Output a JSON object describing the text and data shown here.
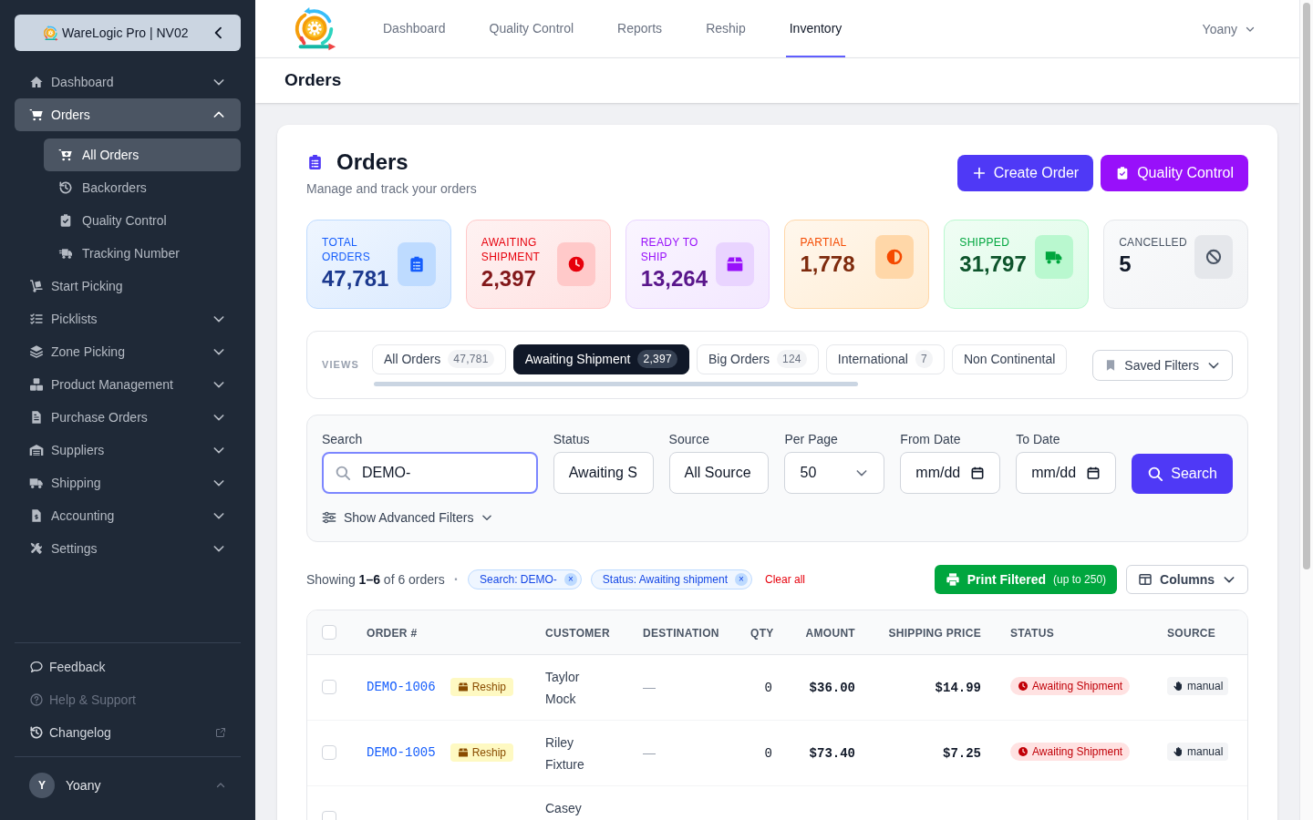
{
  "sidebar": {
    "brand": "WareLogic Pro | NV02",
    "nav": [
      {
        "label": "Dashboard",
        "kind": "group",
        "expanded": false,
        "selected": false
      },
      {
        "label": "Orders",
        "kind": "group",
        "expanded": true,
        "selected": true,
        "children": [
          {
            "label": "All Orders",
            "selected": true
          },
          {
            "label": "Backorders",
            "selected": false
          },
          {
            "label": "Quality Control",
            "selected": false
          },
          {
            "label": "Tracking Number",
            "selected": false
          }
        ]
      },
      {
        "label": "Start Picking",
        "kind": "link",
        "selected": false
      },
      {
        "label": "Picklists",
        "kind": "group",
        "expanded": false,
        "selected": false
      },
      {
        "label": "Zone Picking",
        "kind": "group",
        "expanded": false,
        "selected": false
      },
      {
        "label": "Product Management",
        "kind": "group",
        "expanded": false,
        "selected": false
      },
      {
        "label": "Purchase Orders",
        "kind": "group",
        "expanded": false,
        "selected": false
      },
      {
        "label": "Suppliers",
        "kind": "group",
        "expanded": false,
        "selected": false
      },
      {
        "label": "Shipping",
        "kind": "group",
        "expanded": false,
        "selected": false
      },
      {
        "label": "Accounting",
        "kind": "group",
        "expanded": false,
        "selected": false
      },
      {
        "label": "Settings",
        "kind": "group",
        "expanded": false,
        "selected": false
      }
    ],
    "footer": [
      {
        "label": "Feedback",
        "disabled": false,
        "external": false
      },
      {
        "label": "Help & Support",
        "disabled": true,
        "external": false
      },
      {
        "label": "Changelog",
        "disabled": false,
        "external": true
      }
    ],
    "user": {
      "initial": "Y",
      "name": "Yoany"
    }
  },
  "top_nav": {
    "links": [
      {
        "label": "Dashboard",
        "selected": false
      },
      {
        "label": "Quality Control",
        "selected": false
      },
      {
        "label": "Reports",
        "selected": false
      },
      {
        "label": "Reship",
        "selected": false
      },
      {
        "label": "Inventory",
        "selected": true
      }
    ],
    "user": "Yoany"
  },
  "page_header": {
    "title": "Orders"
  },
  "orders_card": {
    "title": "Orders",
    "subtitle": "Manage and track your orders",
    "actions": [
      {
        "kind": "create",
        "label": "Create Order"
      },
      {
        "kind": "quality",
        "label": "Quality Control"
      }
    ]
  },
  "stats": [
    {
      "kind": "total",
      "label": "TOTAL ORDERS",
      "value": "47,781"
    },
    {
      "kind": "awaiting",
      "label": "AWAITING SHIPMENT",
      "value": "2,397"
    },
    {
      "kind": "ready",
      "label": "READY TO SHIP",
      "value": "13,264"
    },
    {
      "kind": "partial",
      "label": "PARTIAL",
      "value": "1,778"
    },
    {
      "kind": "shipped",
      "label": "SHIPPED",
      "value": "31,797"
    },
    {
      "kind": "cancelled",
      "label": "CANCELLED",
      "value": "5"
    }
  ],
  "views": {
    "label": "VIEWS",
    "tabs": [
      {
        "label": "All Orders",
        "count": "47,781",
        "selected": false
      },
      {
        "label": "Awaiting Shipment",
        "count": "2,397",
        "selected": true
      },
      {
        "label": "Big Orders",
        "count": "124",
        "selected": false
      },
      {
        "label": "International",
        "count": "7",
        "selected": false
      },
      {
        "label": "Non Continental",
        "selected": false
      }
    ],
    "saved_filters": "Saved Filters"
  },
  "filters": {
    "fields": [
      {
        "kind": "search",
        "label": "Search",
        "value": "DEMO-"
      },
      {
        "kind": "select",
        "label": "Status",
        "value": "Awaiting S"
      },
      {
        "kind": "select",
        "label": "Source",
        "value": "All Source"
      },
      {
        "kind": "dropdown",
        "label": "Per Page",
        "value": "50"
      },
      {
        "kind": "date",
        "label": "From Date",
        "value": "mm/dd"
      },
      {
        "kind": "date",
        "label": "To Date",
        "value": "mm/dd"
      }
    ],
    "search_button": "Search",
    "advanced": {
      "label": "Show Advanced Filters",
      "expanded": false
    }
  },
  "results": {
    "summary": "Showing **1–6** of 6 orders",
    "separator": "·",
    "chips": [
      {
        "label": "Search: DEMO-",
        "remove": "×"
      },
      {
        "label": "Status: Awaiting shipment",
        "remove": "×"
      }
    ],
    "clear_all": "Clear all",
    "print": {
      "label": "Print Filtered",
      "note": "(up to 250)"
    },
    "columns_button": "Columns"
  },
  "table": {
    "select_all": {
      "checked": false
    },
    "columns": [
      "ORDER #",
      "CUSTOMER",
      "DESTINATION",
      "QTY",
      "AMOUNT",
      "SHIPPING PRICE",
      "STATUS",
      "SOURCE"
    ],
    "rows": [
      {
        "checked": false,
        "order": "DEMO-1006",
        "tag": "Reship",
        "customer": "Taylor Mock",
        "destination": "—",
        "qty": "0",
        "amount": "$36.00",
        "shipping": "$14.99",
        "status": "Awaiting Shipment",
        "source": "manual"
      },
      {
        "checked": false,
        "order": "DEMO-1005",
        "tag": "Reship",
        "customer": "Riley Fixture",
        "destination": "—",
        "qty": "0",
        "amount": "$73.40",
        "shipping": "$7.25",
        "status": "Awaiting Shipment",
        "source": "manual"
      },
      {
        "checked": false,
        "customer": "Casey"
      }
    ]
  }
}
